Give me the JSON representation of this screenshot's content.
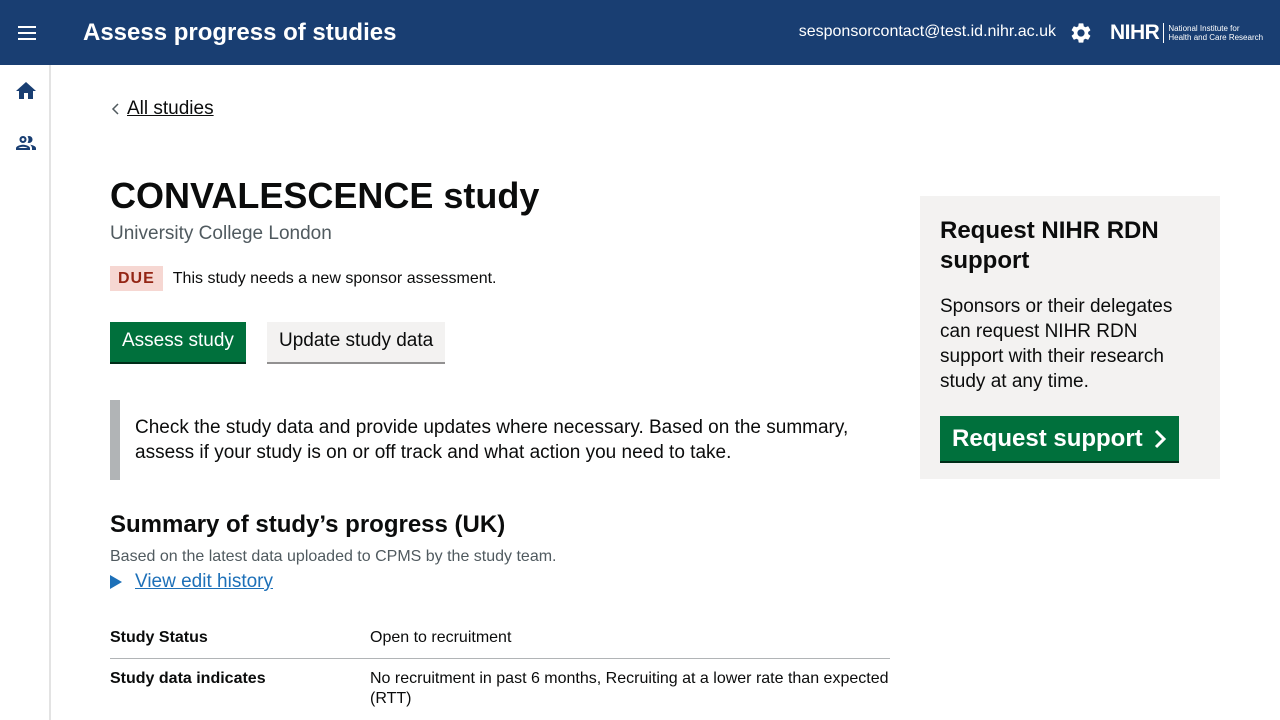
{
  "header": {
    "title": "Assess progress of studies",
    "user_email": "sesponsorcontact@test.id.nihr.ac.uk",
    "brand_name": "NIHR",
    "brand_subtitle": "National Institute for Health and Care Research",
    "icons": {
      "menu": "menu-icon",
      "settings": "gear-icon"
    }
  },
  "sidebar": {
    "items": [
      {
        "icon": "home-icon"
      },
      {
        "icon": "people-icon"
      }
    ]
  },
  "back_link": {
    "label": "All studies"
  },
  "study": {
    "title": "CONVALESCENCE study",
    "organisation": "University College London",
    "status_badge": "DUE",
    "status_text": "This study needs a new sponsor assessment."
  },
  "actions": {
    "primary_label": "Assess study",
    "secondary_label": "Update study data"
  },
  "inset_text": "Check the study data and provide updates where necessary. Based on the summary, assess if your study is on or off track and what action you need to take.",
  "summary": {
    "heading": "Summary of study’s progress (UK)",
    "caption": "Based on the latest data uploaded to CPMS by the study team.",
    "history_link": "View edit history",
    "rows": [
      {
        "label": "Study Status",
        "value": "Open to recruitment"
      },
      {
        "label": "Study data indicates",
        "value": "No recruitment in past 6 months, Recruiting at a lower rate than expected (RTT)"
      }
    ]
  },
  "side_panel": {
    "heading": "Request NIHR RDN support",
    "body": "Sponsors or their delegates can request NIHR RDN support with their research study at any time.",
    "button_label": "Request support"
  },
  "colors": {
    "header_bg": "#193e72",
    "primary_button": "#00703c",
    "link": "#1d70b8",
    "badge_bg": "#f6d7d2",
    "badge_text": "#942514"
  }
}
